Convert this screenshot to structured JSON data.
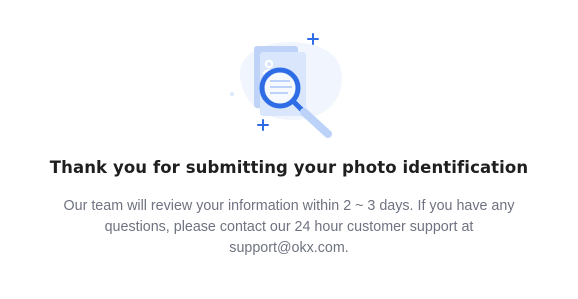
{
  "illustration": {
    "icon": "document-search-icon",
    "colors": {
      "primary": "#2e6de6",
      "light": "#bcd2f8",
      "lighter": "#e4edfc",
      "bg": "#eef3fc"
    }
  },
  "title": "Thank you for submitting your photo identification",
  "message": "Our team will review your information within 2 ~ 3 days. If you have any questions, please contact our 24 hour customer support at support@okx.com."
}
